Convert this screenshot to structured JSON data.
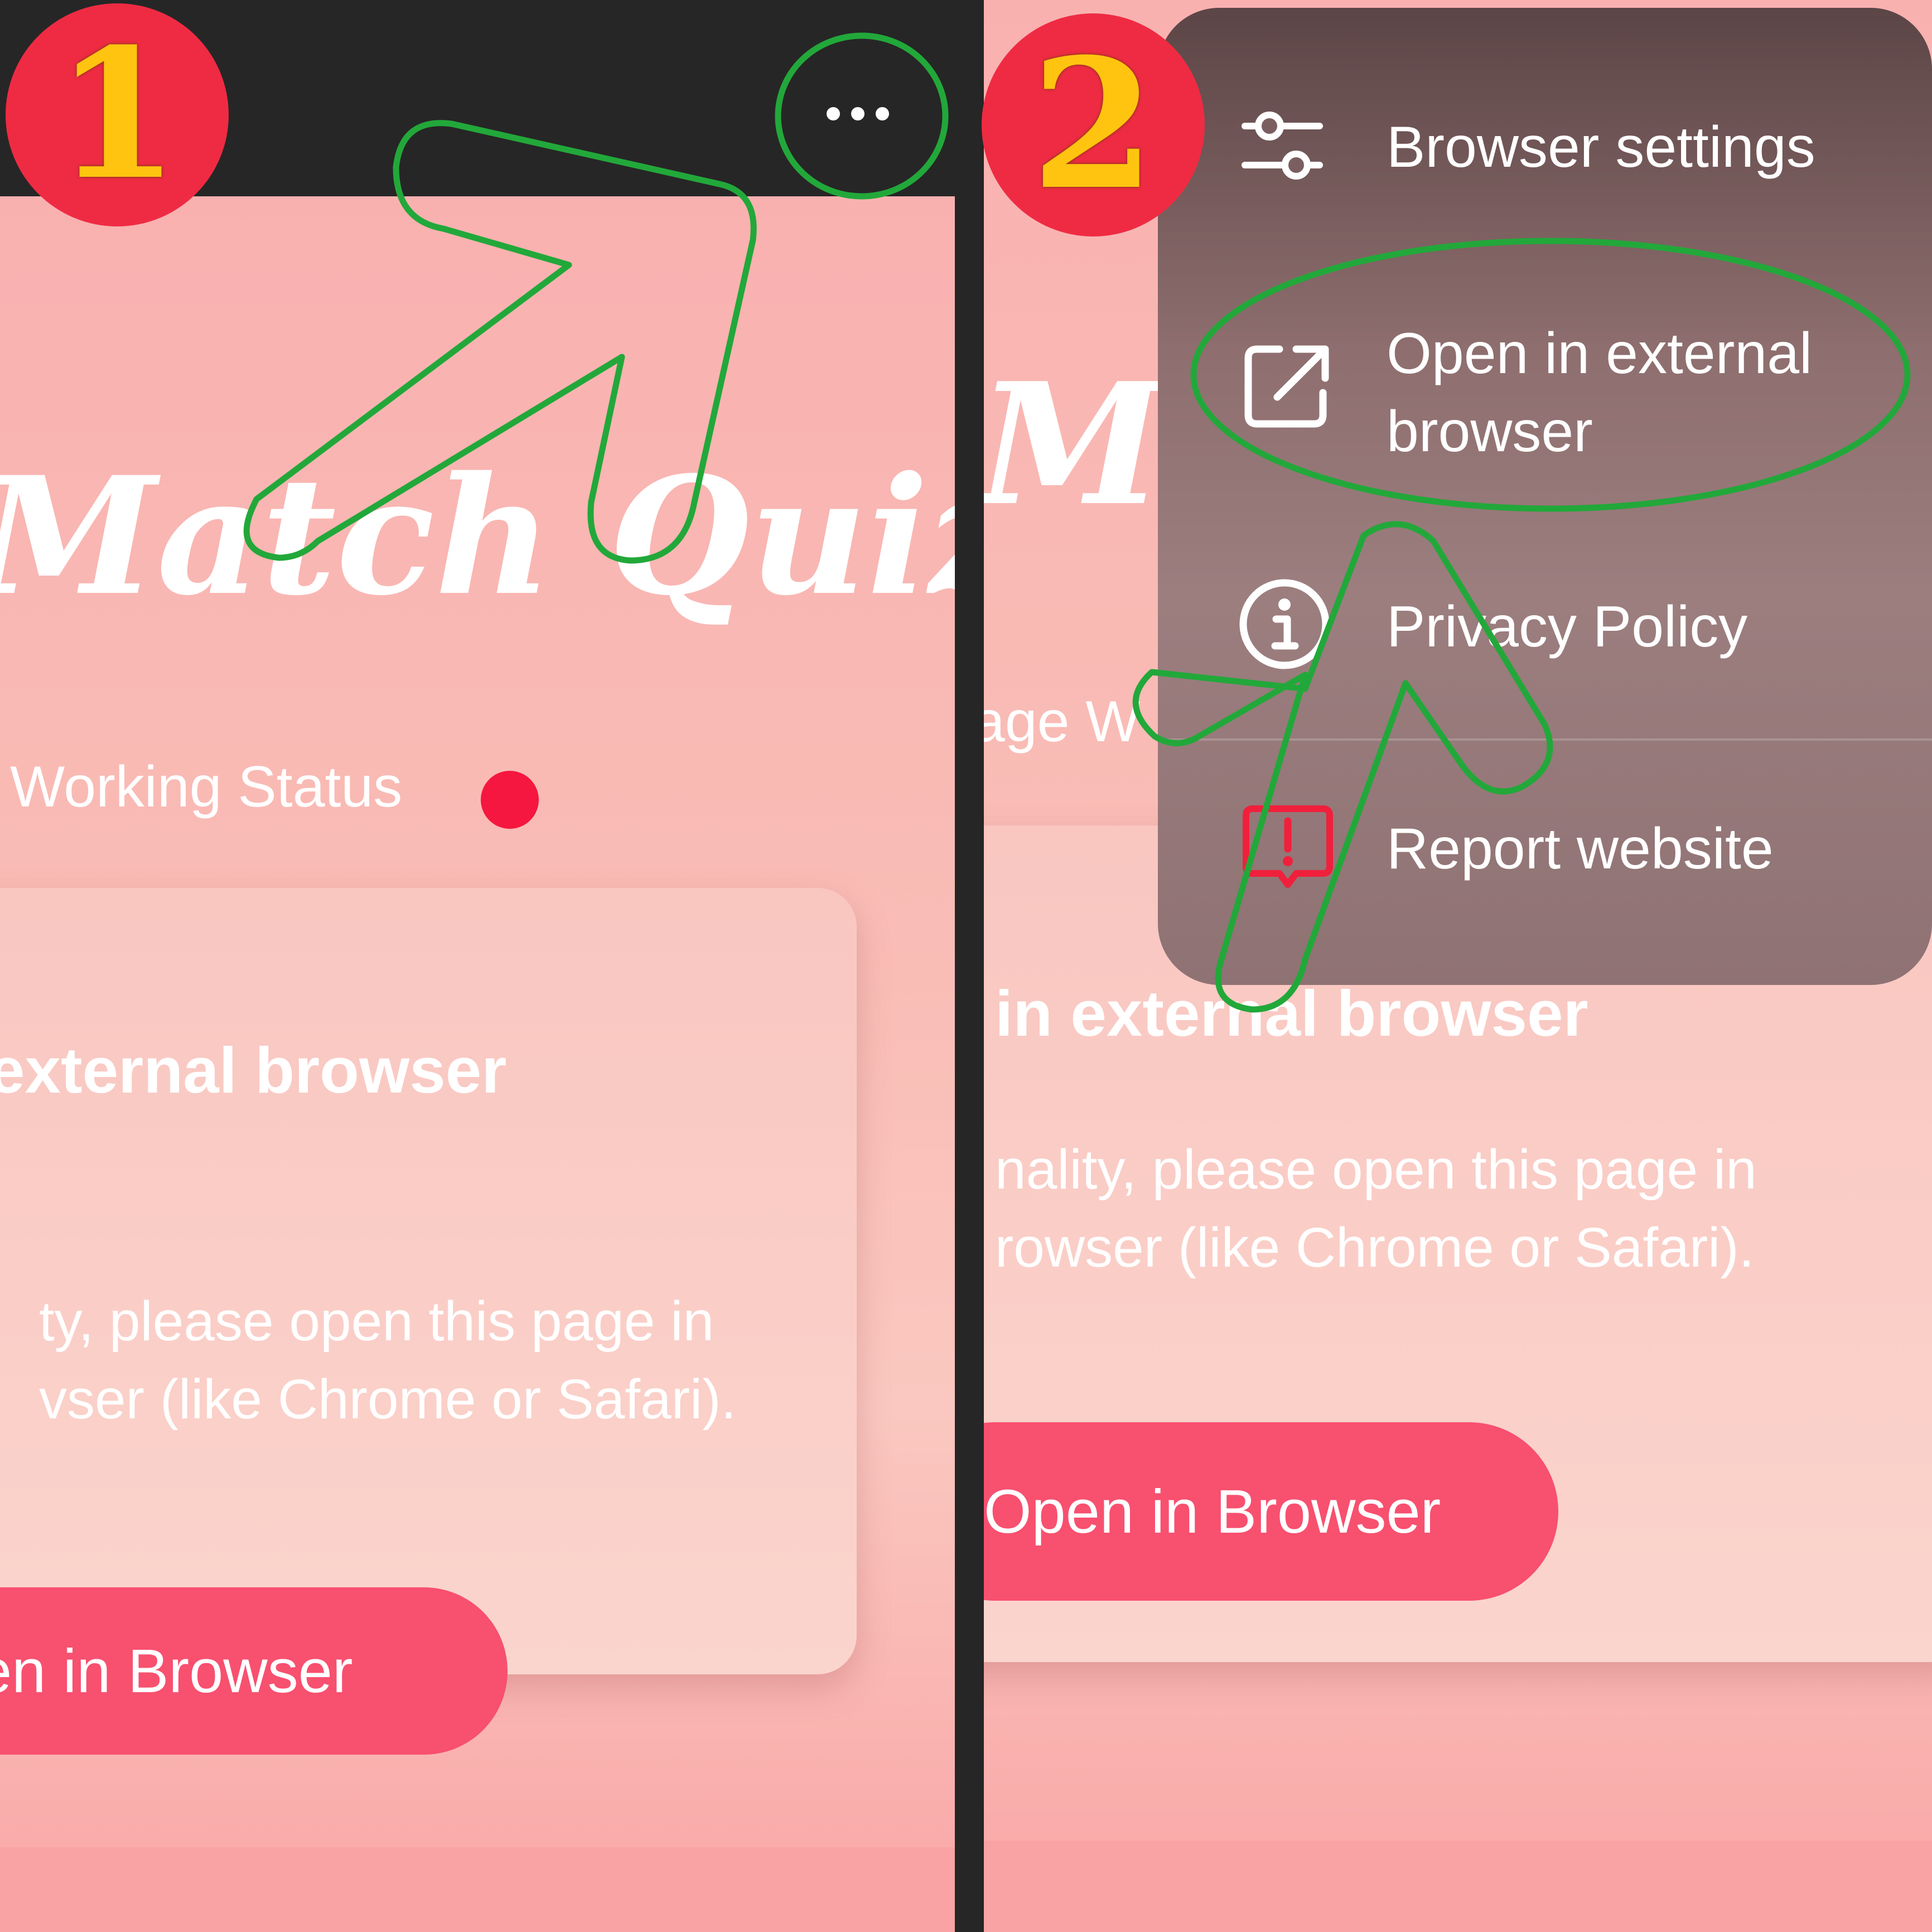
{
  "step1": {
    "badge": "1",
    "app_title": "Match Quiz",
    "status_label": "Working Status",
    "status_color": "#f5173f",
    "card": {
      "heading": "external browser",
      "line1": "ty, please open this page in",
      "line2": "vser (like Chrome or Safari)."
    },
    "open_button_label": "en in Browser",
    "menu_icon": "more-dots-icon"
  },
  "step2": {
    "badge": "2",
    "app_title": "M",
    "status_label": "age W",
    "card": {
      "heading": "in external browser",
      "line1": "nality, please open this page in",
      "line2": "rowser (like Chrome or Safari)."
    },
    "open_button_label": "Open in Browser",
    "menu": {
      "items": [
        {
          "label": "Browser settings",
          "icon": "sliders-icon"
        },
        {
          "label_line1": "Open in external",
          "label_line2": "browser",
          "icon": "external-link-icon"
        },
        {
          "label": "Privacy Policy",
          "icon": "info-icon"
        },
        {
          "label": "Report website",
          "icon": "report-icon"
        }
      ]
    }
  },
  "colors": {
    "background": "#262626",
    "accent_button": "#f8506f",
    "badge_red": "#ef2b43",
    "badge_digit": "#ffc410",
    "highlight_green": "#22a83a",
    "report_icon_red": "#f0203c"
  }
}
